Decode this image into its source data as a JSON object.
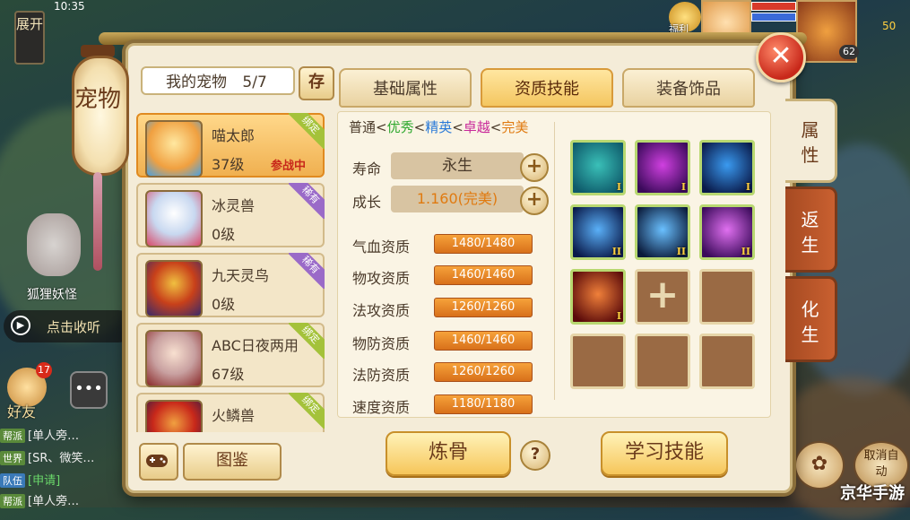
{
  "status_bar": {
    "time": "10:35"
  },
  "side": {
    "expand_label": "展开",
    "monster_name": "狐狸妖怪",
    "listen_label": "点击收听",
    "friends_label": "好友",
    "friends_count": "17",
    "chat": [
      {
        "tag": "帮派",
        "text": "[单人旁…"
      },
      {
        "tag": "世界",
        "text": "[SR、微笑…"
      },
      {
        "tag": "队伍",
        "text": "[申请]"
      },
      {
        "tag": "帮派",
        "text": "[单人旁…"
      }
    ]
  },
  "top_right": {
    "welfare_label": "福利",
    "level": "62",
    "gold": "50"
  },
  "lantern_title": "宠物",
  "pets_header": {
    "label": "我的宠物",
    "count": "5/7",
    "store_label": "存"
  },
  "pets": [
    {
      "name": "喵太郎",
      "level": "37级",
      "status": "参战中",
      "badge": "绑定",
      "badge_type": "bound",
      "selected": true
    },
    {
      "name": "冰灵兽",
      "level": "0级",
      "status": "",
      "badge": "稀有",
      "badge_type": "rare",
      "selected": false
    },
    {
      "name": "九天灵鸟",
      "level": "0级",
      "status": "",
      "badge": "稀有",
      "badge_type": "rare",
      "selected": false
    },
    {
      "name": "ABC日夜两用",
      "level": "67级",
      "status": "",
      "badge": "绑定",
      "badge_type": "bound",
      "selected": false
    },
    {
      "name": "火鳞兽",
      "level": "",
      "status": "",
      "badge": "绑定",
      "badge_type": "bound",
      "selected": false
    }
  ],
  "bottom_left": {
    "atlas_label": "图鉴"
  },
  "tabs": {
    "basic": "基础属性",
    "aptitude": "资质技能",
    "equip": "装备饰品"
  },
  "side_tabs": {
    "attr": "属性",
    "return": "返生",
    "transform": "化生"
  },
  "quality": {
    "normal": "普通",
    "lt": "<",
    "good": "优秀",
    "elite": "精英",
    "super": "卓越",
    "perfect": "完美"
  },
  "life": {
    "label": "寿命",
    "value": "永生"
  },
  "growth": {
    "label": "成长",
    "value": "1.160(完美)"
  },
  "aptitudes": [
    {
      "label": "气血资质",
      "value": "1480/1480",
      "ratio": 1.0
    },
    {
      "label": "物攻资质",
      "value": "1460/1460",
      "ratio": 1.0
    },
    {
      "label": "法攻资质",
      "value": "1260/1260",
      "ratio": 1.0
    },
    {
      "label": "物防资质",
      "value": "1460/1460",
      "ratio": 1.0
    },
    {
      "label": "法防资质",
      "value": "1260/1260",
      "ratio": 1.0
    },
    {
      "label": "速度资质",
      "value": "1180/1180",
      "ratio": 1.0
    }
  ],
  "skills": [
    {
      "type": "icon",
      "icon": "teal-spirit-icon",
      "tier": "I",
      "color1": "#3ac0b8",
      "color2": "#0e5a6a"
    },
    {
      "type": "icon",
      "icon": "purple-vortex-icon",
      "tier": "I",
      "color1": "#d040e0",
      "color2": "#3a0a5a"
    },
    {
      "type": "icon",
      "icon": "blue-meditation-icon",
      "tier": "I",
      "color1": "#3a9af0",
      "color2": "#0a1a4a"
    },
    {
      "type": "icon",
      "icon": "blue-slash-icon",
      "tier": "II",
      "color1": "#5ab0f8",
      "color2": "#0a1a4a"
    },
    {
      "type": "icon",
      "icon": "blue-comet-icon",
      "tier": "II",
      "color1": "#6ac0ff",
      "color2": "#0a1a3a"
    },
    {
      "type": "icon",
      "icon": "purple-heart-icon",
      "tier": "II",
      "color1": "#e070f0",
      "color2": "#3a0a5a"
    },
    {
      "type": "icon",
      "icon": "red-claw-icon",
      "tier": "I",
      "color1": "#f0803a",
      "color2": "#5a0a0a"
    },
    {
      "type": "add",
      "icon": "plus-icon"
    },
    {
      "type": "empty"
    },
    {
      "type": "empty"
    },
    {
      "type": "empty"
    },
    {
      "type": "empty"
    }
  ],
  "actions": {
    "refine": "炼骨",
    "help": "?",
    "learn": "学习技能"
  },
  "bottom_right": {
    "cancel_auto": "取消自动"
  },
  "watermark": "京华手游"
}
